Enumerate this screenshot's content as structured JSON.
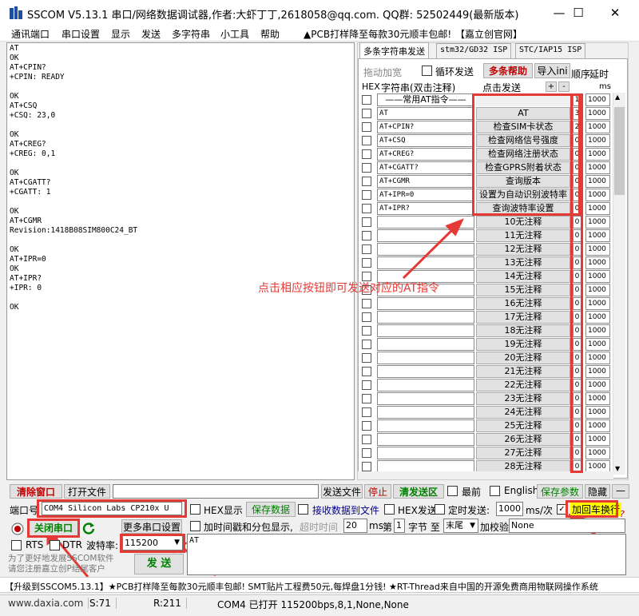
{
  "window": {
    "title": "SSCOM V5.13.1 串口/网络数据调试器,作者:大虾丁丁,2618058@qq.com. QQ群:  52502449(最新版本)",
    "minimize": "—",
    "maximize": "☐",
    "close": "✕"
  },
  "menu": {
    "items": [
      "通讯端口",
      "串口设置",
      "显示",
      "发送",
      "多字符串",
      "小工具",
      "帮助"
    ],
    "promo": "▲PCB打样降至每款30元顺丰包邮!",
    "link": "【嘉立创官网】"
  },
  "receive": {
    "lines": [
      "AT",
      "OK",
      "AT+CPIN?",
      "+CPIN: READY",
      "",
      "OK",
      "AT+CSQ",
      "+CSQ: 23,0",
      "",
      "OK",
      "AT+CREG?",
      "+CREG: 0,1",
      "",
      "OK",
      "AT+CGATT?",
      "+CGATT: 1",
      "",
      "OK",
      "AT+CGMR",
      "Revision:1418B08SIM800C24_BT",
      "",
      "OK",
      "AT+IPR=0",
      "OK",
      "AT+IPR?",
      "+IPR: 0",
      "",
      "OK"
    ]
  },
  "multistring": {
    "tabs": [
      "多条字符串发送",
      "stm32/GD32 ISP",
      "STC/IAP15 ISP"
    ],
    "drag_label": "拖动加宽",
    "loop_label": "循环发送",
    "help_label": "多条帮助",
    "import_label": "导入ini",
    "col_order": "顺序",
    "col_delay": "延时",
    "col_hex": "HEX",
    "col_string": "字符串(双击注释)",
    "col_click": "点击发送",
    "plus": "+",
    "minus": "-",
    "ms": "ms",
    "header_row": {
      "cmd": "——常用AT指令——",
      "button": "",
      "order": "1",
      "delay": "1000"
    },
    "rows": [
      {
        "cmd": "AT",
        "button": "AT",
        "order": "3",
        "delay": "1000"
      },
      {
        "cmd": "AT+CPIN?",
        "button": "检查SIM卡状态",
        "order": "2",
        "delay": "1000"
      },
      {
        "cmd": "AT+CSQ",
        "button": "检查网络信号强度",
        "order": "0",
        "delay": "1000"
      },
      {
        "cmd": "AT+CREG?",
        "button": "检查网络注册状态",
        "order": "0",
        "delay": "1000"
      },
      {
        "cmd": "AT+CGATT?",
        "button": "检查GPRS附着状态",
        "order": "0",
        "delay": "1000"
      },
      {
        "cmd": "AT+CGMR",
        "button": "查询版本",
        "order": "0",
        "delay": "1000"
      },
      {
        "cmd": "AT+IPR=0",
        "button": "设置为自动识别波特率",
        "order": "0",
        "delay": "1000"
      },
      {
        "cmd": "AT+IPR?",
        "button": "查询波特率设置",
        "order": "0",
        "delay": "1000"
      },
      {
        "cmd": "",
        "button": "10无注释",
        "order": "0",
        "delay": "1000"
      },
      {
        "cmd": "",
        "button": "11无注释",
        "order": "0",
        "delay": "1000"
      },
      {
        "cmd": "",
        "button": "12无注释",
        "order": "0",
        "delay": "1000"
      },
      {
        "cmd": "",
        "button": "13无注释",
        "order": "0",
        "delay": "1000"
      },
      {
        "cmd": "",
        "button": "14无注释",
        "order": "0",
        "delay": "1000"
      },
      {
        "cmd": "",
        "button": "15无注释",
        "order": "0",
        "delay": "1000"
      },
      {
        "cmd": "",
        "button": "16无注释",
        "order": "0",
        "delay": "1000"
      },
      {
        "cmd": "",
        "button": "17无注释",
        "order": "0",
        "delay": "1000"
      },
      {
        "cmd": "",
        "button": "18无注释",
        "order": "0",
        "delay": "1000"
      },
      {
        "cmd": "",
        "button": "19无注释",
        "order": "0",
        "delay": "1000"
      },
      {
        "cmd": "",
        "button": "20无注释",
        "order": "0",
        "delay": "1000"
      },
      {
        "cmd": "",
        "button": "21无注释",
        "order": "0",
        "delay": "1000"
      },
      {
        "cmd": "",
        "button": "22无注释",
        "order": "0",
        "delay": "1000"
      },
      {
        "cmd": "",
        "button": "23无注释",
        "order": "0",
        "delay": "1000"
      },
      {
        "cmd": "",
        "button": "24无注释",
        "order": "0",
        "delay": "1000"
      },
      {
        "cmd": "",
        "button": "25无注释",
        "order": "0",
        "delay": "1000"
      },
      {
        "cmd": "",
        "button": "26无注释",
        "order": "0",
        "delay": "1000"
      },
      {
        "cmd": "",
        "button": "27无注释",
        "order": "0",
        "delay": "1000"
      },
      {
        "cmd": "",
        "button": "28无注释",
        "order": "0",
        "delay": "1000"
      }
    ]
  },
  "annotation": "点击相应按钮即可发送对应的AT指令",
  "toolbar": {
    "clear_window": "清除窗口",
    "open_file": "打开文件",
    "send_file": "发送文件",
    "stop": "停止",
    "clear_send": "清发送区",
    "topmost": "最前",
    "english": "English",
    "save_params": "保存参数",
    "hide": "隐藏",
    "collapse": "—"
  },
  "port": {
    "port_label": "端口号",
    "port_value": "COM4 Silicon Labs CP210x U",
    "hex_display": "HEX显示",
    "save_data": "保存数据",
    "recv_to_file": "接收数据到文件",
    "hex_send": "HEX发送",
    "timed_send": "定时发送:",
    "timed_value": "1000",
    "timed_unit": "ms/次",
    "add_crlf": "加回车换行",
    "close_port": "关闭串口",
    "more_settings": "更多串口设置",
    "timestamp": "加时间戳和分包显示,",
    "timeout_label": "超时时间",
    "timeout_value": "20",
    "ms": "ms",
    "nth_label": "第",
    "nth_value": "1",
    "byte_label": "字节 至",
    "end_value": "末尾",
    "checksum_label": "加校验",
    "checksum_value": "None",
    "rts": "RTS",
    "dtr": "DTR",
    "baud_label": "波特率:",
    "baud_value": "115200",
    "send_text": "AT",
    "promo_text": "为了更好地发展SSCOM软件\n请您注册嘉立创P结尾客户",
    "send_button": "发 送",
    "help_icon": "?"
  },
  "ticker": "【升级到SSCOM5.13.1】★PCB打样降至每款30元顺丰包邮! SMT贴片工程费50元,每焊盘1分钱! ★RT-Thread来自中国的开源免费商用物联网操作系统",
  "status": {
    "site": "www.daxia.com",
    "sent": "S:71",
    "received": "R:211",
    "port_status": "COM4 已打开  115200bps,8,1,None,None"
  },
  "colors": {
    "annotation_red": "#e53935",
    "green_text": "#008000",
    "red_text": "#c00000",
    "yellow": "#ffff00"
  }
}
